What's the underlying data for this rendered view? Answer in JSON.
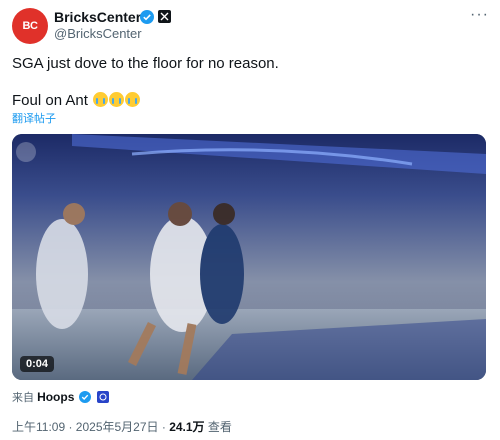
{
  "author": {
    "avatar_text": "BC",
    "name": "BricksCenter",
    "handle": "@BricksCenter",
    "more_icon": "ellipsis-icon"
  },
  "tweet": {
    "line1": "SGA just dove to the floor for no reason.",
    "line2": "Foul on Ant",
    "emoji_count": 3,
    "translate_label": "翻译帖子"
  },
  "video": {
    "duration": "0:04",
    "watermark": "NBA"
  },
  "source": {
    "prefix": "来自",
    "account": "Hoops"
  },
  "meta": {
    "time_date": "上午11:09 · 2025年5月27日 · ",
    "views": "24.1万",
    "views_label": " 查看"
  },
  "colors": {
    "accent": "#1d9bf0",
    "avatar_bg": "#e0312a",
    "secondary_text": "#536471"
  }
}
